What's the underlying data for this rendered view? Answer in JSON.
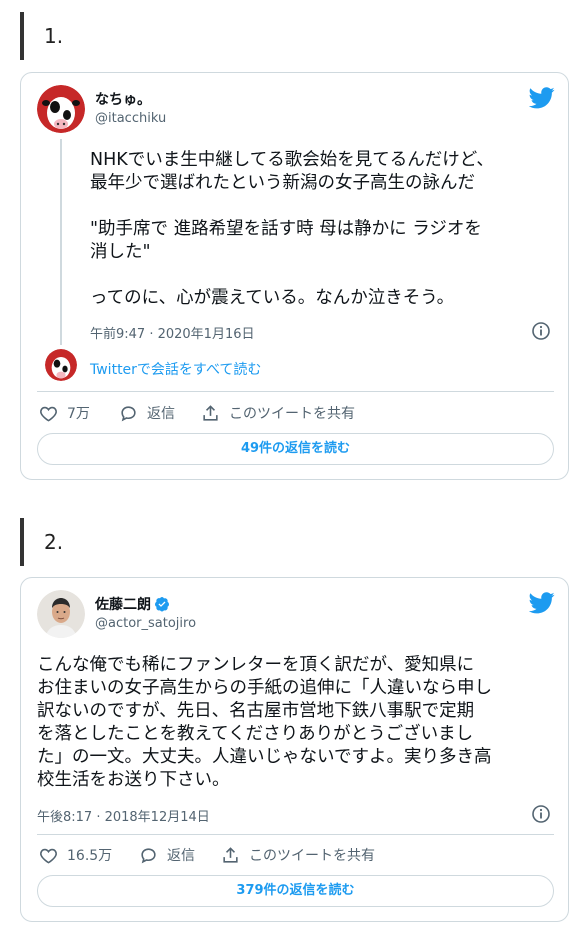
{
  "sections": [
    {
      "number": "1.",
      "tweet": {
        "display_name": "なちゅ。",
        "handle": "@itacchiku",
        "text": "NHKでいま生中継してる歌会始を見てるんだけど、\n最年少で選ばれたという新潟の女子高生の詠んだ\n\n\"助手席で 進路希望を話す時 母は静かに ラジオを\n消した\"\n\nってのに、心が震えている。なんか泣きそう。",
        "timestamp": "午前9:47 · 2020年1月16日",
        "thread_link": "Twitterで会話をすべて読む",
        "likes": "7万",
        "reply_label": "返信",
        "share_label": "このツイートを共有",
        "read_replies": "49件の返信を読む"
      }
    },
    {
      "number": "2.",
      "tweet": {
        "display_name": "佐藤二朗",
        "handle": "@actor_satojiro",
        "verified": true,
        "text": "こんな俺でも稀にファンレターを頂く訳だが、愛知県に\nお住まいの女子高生からの手紙の追伸に「人違いなら申し\n訳ないのですが、先日、名古屋市営地下鉄八事駅で定期\nを落としたことを教えてくださりありがとうございまし\nた」の一文。大丈夫。人違いじゃないですよ。実り多き高\n校生活をお送り下さい。",
        "timestamp": "午後8:17 · 2018年12月14日",
        "likes": "16.5万",
        "reply_label": "返信",
        "share_label": "このツイートを共有",
        "read_replies": "379件の返信を読む"
      }
    }
  ],
  "colors": {
    "accent": "#1d9bf0",
    "verified": "#1d9bf0",
    "text_primary": "#0f1419",
    "text_secondary": "#536471",
    "border": "#cfd9de"
  },
  "icons": [
    "twitter-bird-icon",
    "heart-icon",
    "reply-icon",
    "share-icon",
    "info-icon",
    "verified-badge-icon"
  ]
}
